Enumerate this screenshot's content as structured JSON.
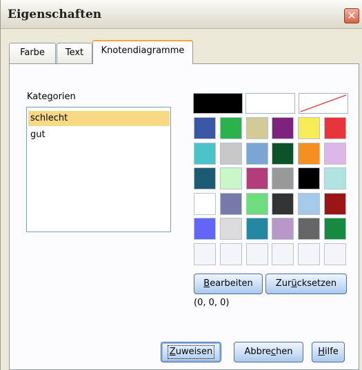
{
  "window": {
    "title": "Eigenschaften",
    "close_glyph": "✕"
  },
  "tabs": [
    {
      "label": "Farbe",
      "active": false
    },
    {
      "label": "Text",
      "active": false
    },
    {
      "label": "Knotendiagramme",
      "active": true
    }
  ],
  "categories": {
    "label_pre": "Kate",
    "label_mnemonic": "g",
    "label_post": "orien",
    "items": [
      {
        "label": "schlecht",
        "selected": true
      },
      {
        "label": "gut",
        "selected": false
      }
    ]
  },
  "palette": {
    "top_row": [
      "#000000",
      "#ffffff",
      "none-red-diagonal"
    ],
    "grid": [
      [
        "#3c56a6",
        "#2bb24c",
        "#d2cb95",
        "#7b237d",
        "#f8ec56",
        "#e8343a"
      ],
      [
        "#4bc2c5",
        "#c8c8c8",
        "#7ba6d3",
        "#0c5329",
        "#f58f1f",
        "#ddb8e6"
      ],
      [
        "#1b5c74",
        "#c9f7c8",
        "#b33c7b",
        "#999999",
        "#000000",
        "#b2e3e3"
      ],
      [
        "#ffffff",
        "#7679a9",
        "#6fdc7e",
        "#333333",
        "#a7c9ea",
        "#9b1517"
      ],
      [
        "#6365f5",
        "#dcdcdc",
        "#2588a3",
        "#b898c9",
        "#666666",
        "#158a40"
      ],
      [
        "empty",
        "empty",
        "empty",
        "empty",
        "empty",
        "empty"
      ]
    ],
    "rgb_value": "(0, 0, 0)"
  },
  "buttons": {
    "edit": {
      "pre": "",
      "mnemonic": "B",
      "post": "earbeiten"
    },
    "reset": {
      "pre": "Zur",
      "mnemonic": "ü",
      "post": "cksetzen"
    },
    "apply": {
      "pre": "",
      "mnemonic": "Z",
      "post": "uweisen"
    },
    "cancel": {
      "pre": "Abbre",
      "mnemonic": "c",
      "post": "hen"
    },
    "help": {
      "pre": "",
      "mnemonic": "H",
      "post": "ilfe"
    }
  },
  "colors": {
    "accent_tab": "#f7a53b",
    "selection": "#f7d883",
    "button_border": "#003c74"
  }
}
